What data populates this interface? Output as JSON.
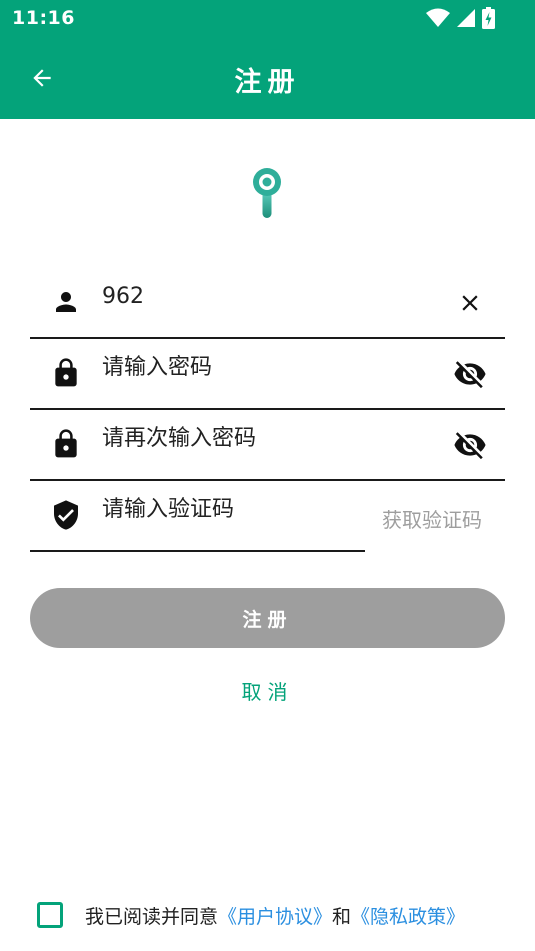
{
  "status_bar": {
    "time": "11:16"
  },
  "app_bar": {
    "title": "注册"
  },
  "form": {
    "username": {
      "value": "962"
    },
    "password": {
      "placeholder": "请输入密码"
    },
    "confirm_password": {
      "placeholder": "请再次输入密码"
    },
    "verification_code": {
      "placeholder": "请输入验证码",
      "get_code_label": "获取验证码"
    }
  },
  "actions": {
    "register_label": "注册",
    "cancel_label": "取消"
  },
  "agreement": {
    "prefix": "我已阅读并同意",
    "user_agreement": "《用户协议》",
    "and": "和",
    "privacy_policy": "《隐私政策》"
  },
  "colors": {
    "brand": "#04a37a",
    "disabled_button": "#9e9e9e",
    "link": "#2b8fe0"
  },
  "icons": {
    "username": "person-icon",
    "password": "lock-icon",
    "confirm_password": "lock-icon",
    "verification_code": "shield-check-icon",
    "clear": "close-icon",
    "toggle_visibility": "eye-off-icon"
  }
}
